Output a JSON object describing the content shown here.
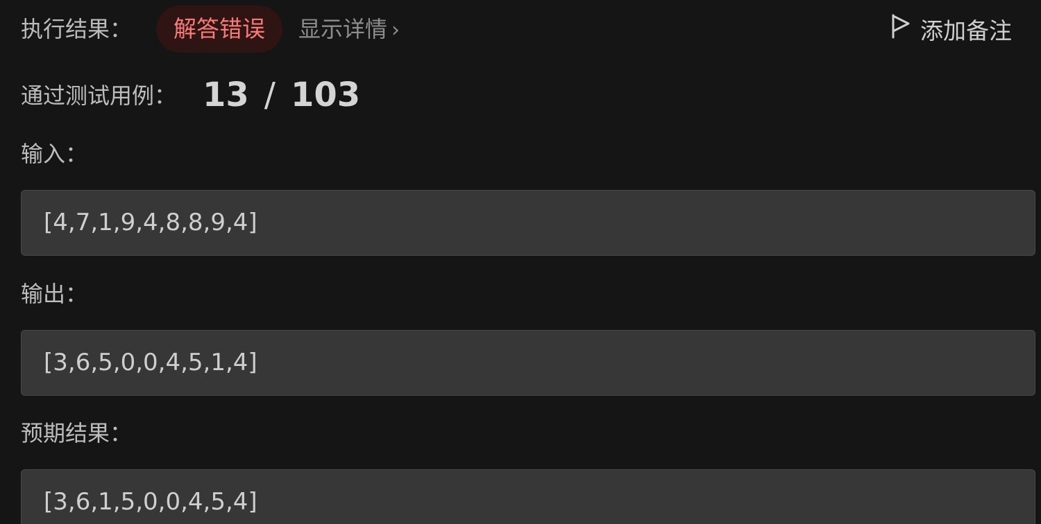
{
  "result": {
    "label": "执行结果：",
    "status": "解答错误",
    "details_link": "显示详情",
    "add_note": "添加备注"
  },
  "testcases": {
    "label": "通过测试用例：",
    "passed": "13",
    "separator": "/",
    "total": "103"
  },
  "input": {
    "label": "输入：",
    "value": "[4,7,1,9,4,8,8,9,4]"
  },
  "output": {
    "label": "输出：",
    "value": "[3,6,5,0,0,4,5,1,4]"
  },
  "expected": {
    "label": "预期结果：",
    "value": "[3,6,1,5,0,0,4,5,4]"
  },
  "icons": {
    "chevron": "chevron-right-icon",
    "flag": "flag-icon"
  },
  "colors": {
    "background": "#151515",
    "error_text": "#f87a76",
    "error_bg": "#2f1414",
    "box_bg": "#373737"
  }
}
